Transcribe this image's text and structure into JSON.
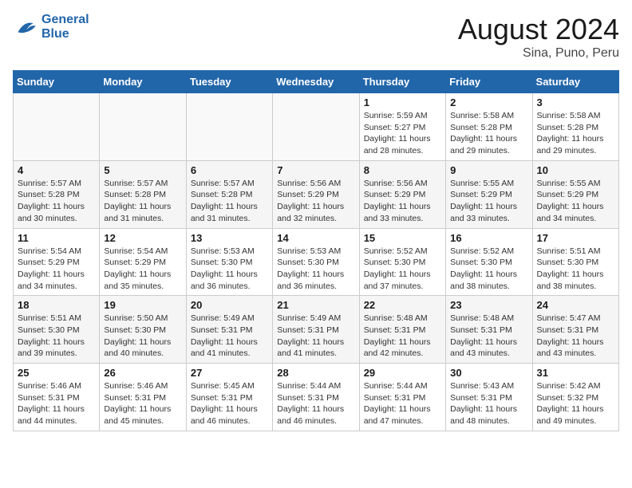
{
  "header": {
    "logo_line1": "General",
    "logo_line2": "Blue",
    "month": "August 2024",
    "location": "Sina, Puno, Peru"
  },
  "weekdays": [
    "Sunday",
    "Monday",
    "Tuesday",
    "Wednesday",
    "Thursday",
    "Friday",
    "Saturday"
  ],
  "weeks": [
    [
      {
        "day": "",
        "empty": true
      },
      {
        "day": "",
        "empty": true
      },
      {
        "day": "",
        "empty": true
      },
      {
        "day": "",
        "empty": true
      },
      {
        "day": "1",
        "sunrise": "5:59 AM",
        "sunset": "5:27 PM",
        "daylight": "11 hours and 28 minutes."
      },
      {
        "day": "2",
        "sunrise": "5:58 AM",
        "sunset": "5:28 PM",
        "daylight": "11 hours and 29 minutes."
      },
      {
        "day": "3",
        "sunrise": "5:58 AM",
        "sunset": "5:28 PM",
        "daylight": "11 hours and 29 minutes."
      }
    ],
    [
      {
        "day": "4",
        "sunrise": "5:57 AM",
        "sunset": "5:28 PM",
        "daylight": "11 hours and 30 minutes."
      },
      {
        "day": "5",
        "sunrise": "5:57 AM",
        "sunset": "5:28 PM",
        "daylight": "11 hours and 31 minutes."
      },
      {
        "day": "6",
        "sunrise": "5:57 AM",
        "sunset": "5:28 PM",
        "daylight": "11 hours and 31 minutes."
      },
      {
        "day": "7",
        "sunrise": "5:56 AM",
        "sunset": "5:29 PM",
        "daylight": "11 hours and 32 minutes."
      },
      {
        "day": "8",
        "sunrise": "5:56 AM",
        "sunset": "5:29 PM",
        "daylight": "11 hours and 33 minutes."
      },
      {
        "day": "9",
        "sunrise": "5:55 AM",
        "sunset": "5:29 PM",
        "daylight": "11 hours and 33 minutes."
      },
      {
        "day": "10",
        "sunrise": "5:55 AM",
        "sunset": "5:29 PM",
        "daylight": "11 hours and 34 minutes."
      }
    ],
    [
      {
        "day": "11",
        "sunrise": "5:54 AM",
        "sunset": "5:29 PM",
        "daylight": "11 hours and 34 minutes."
      },
      {
        "day": "12",
        "sunrise": "5:54 AM",
        "sunset": "5:29 PM",
        "daylight": "11 hours and 35 minutes."
      },
      {
        "day": "13",
        "sunrise": "5:53 AM",
        "sunset": "5:30 PM",
        "daylight": "11 hours and 36 minutes."
      },
      {
        "day": "14",
        "sunrise": "5:53 AM",
        "sunset": "5:30 PM",
        "daylight": "11 hours and 36 minutes."
      },
      {
        "day": "15",
        "sunrise": "5:52 AM",
        "sunset": "5:30 PM",
        "daylight": "11 hours and 37 minutes."
      },
      {
        "day": "16",
        "sunrise": "5:52 AM",
        "sunset": "5:30 PM",
        "daylight": "11 hours and 38 minutes."
      },
      {
        "day": "17",
        "sunrise": "5:51 AM",
        "sunset": "5:30 PM",
        "daylight": "11 hours and 38 minutes."
      }
    ],
    [
      {
        "day": "18",
        "sunrise": "5:51 AM",
        "sunset": "5:30 PM",
        "daylight": "11 hours and 39 minutes."
      },
      {
        "day": "19",
        "sunrise": "5:50 AM",
        "sunset": "5:30 PM",
        "daylight": "11 hours and 40 minutes."
      },
      {
        "day": "20",
        "sunrise": "5:49 AM",
        "sunset": "5:31 PM",
        "daylight": "11 hours and 41 minutes."
      },
      {
        "day": "21",
        "sunrise": "5:49 AM",
        "sunset": "5:31 PM",
        "daylight": "11 hours and 41 minutes."
      },
      {
        "day": "22",
        "sunrise": "5:48 AM",
        "sunset": "5:31 PM",
        "daylight": "11 hours and 42 minutes."
      },
      {
        "day": "23",
        "sunrise": "5:48 AM",
        "sunset": "5:31 PM",
        "daylight": "11 hours and 43 minutes."
      },
      {
        "day": "24",
        "sunrise": "5:47 AM",
        "sunset": "5:31 PM",
        "daylight": "11 hours and 43 minutes."
      }
    ],
    [
      {
        "day": "25",
        "sunrise": "5:46 AM",
        "sunset": "5:31 PM",
        "daylight": "11 hours and 44 minutes."
      },
      {
        "day": "26",
        "sunrise": "5:46 AM",
        "sunset": "5:31 PM",
        "daylight": "11 hours and 45 minutes."
      },
      {
        "day": "27",
        "sunrise": "5:45 AM",
        "sunset": "5:31 PM",
        "daylight": "11 hours and 46 minutes."
      },
      {
        "day": "28",
        "sunrise": "5:44 AM",
        "sunset": "5:31 PM",
        "daylight": "11 hours and 46 minutes."
      },
      {
        "day": "29",
        "sunrise": "5:44 AM",
        "sunset": "5:31 PM",
        "daylight": "11 hours and 47 minutes."
      },
      {
        "day": "30",
        "sunrise": "5:43 AM",
        "sunset": "5:31 PM",
        "daylight": "11 hours and 48 minutes."
      },
      {
        "day": "31",
        "sunrise": "5:42 AM",
        "sunset": "5:32 PM",
        "daylight": "11 hours and 49 minutes."
      }
    ]
  ]
}
